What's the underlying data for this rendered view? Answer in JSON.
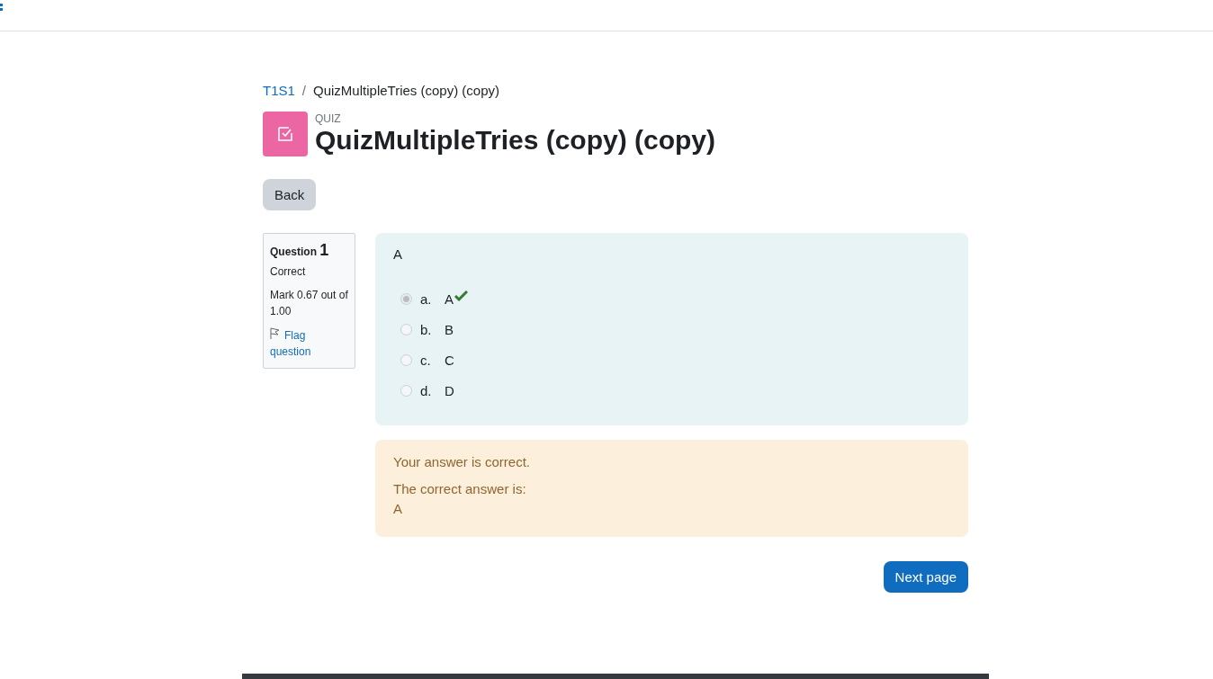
{
  "breadcrumb": {
    "separator": "/",
    "items": [
      {
        "label": "T1S1",
        "kind": "link"
      },
      {
        "label": "QuizMultipleTries (copy) (copy)",
        "kind": "current"
      }
    ]
  },
  "activity": {
    "type_label": "QUIZ",
    "title": "QuizMultipleTries (copy) (copy)"
  },
  "back_button": "Back",
  "question_info": {
    "label": "Question",
    "number": "1",
    "state": "Correct",
    "mark": "Mark 0.67 out of 1.00",
    "flag": "Flag question",
    "flagged": false
  },
  "question": {
    "text": "A",
    "options": [
      {
        "letter": "a.",
        "text": "A",
        "selected": true,
        "correct": true
      },
      {
        "letter": "b.",
        "text": "B",
        "selected": false,
        "correct": false
      },
      {
        "letter": "c.",
        "text": "C",
        "selected": false,
        "correct": false
      },
      {
        "letter": "d.",
        "text": "D",
        "selected": false,
        "correct": false
      }
    ]
  },
  "feedback": {
    "result": "Your answer is correct.",
    "correct_label": "The correct answer is:",
    "correct_answer": "A"
  },
  "next_button": "Next page"
}
